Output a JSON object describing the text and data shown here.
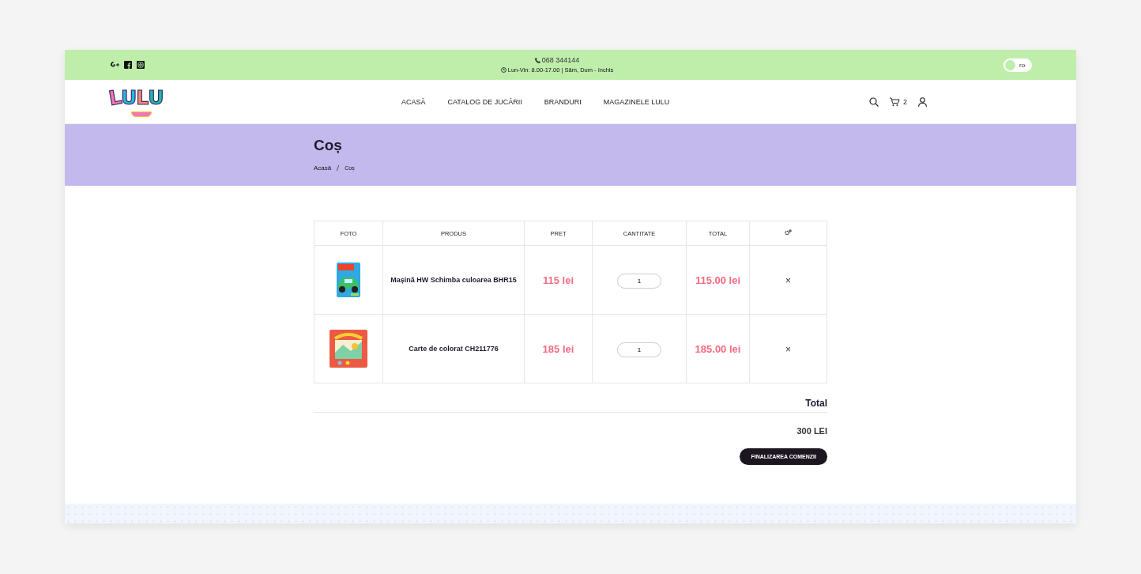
{
  "topbar": {
    "phone": "068 344144",
    "hours": "Lun-Vin: 8.00-17.00 | Săm, Dum - închis",
    "social": [
      {
        "kind": "gplus"
      },
      {
        "kind": "facebook"
      },
      {
        "kind": "instagram"
      }
    ],
    "language": {
      "label": "ro",
      "on": false
    }
  },
  "header": {
    "logo": "LULU",
    "nav": [
      {
        "label": "ACASĂ"
      },
      {
        "label": "CATALOG DE JUCĂRII"
      },
      {
        "label": "BRANDURI"
      },
      {
        "label": "MAGAZINELE LULU"
      }
    ],
    "cart_count": "2"
  },
  "banner": {
    "title": "Coș",
    "breadcrumb": [
      "Acasă",
      "Coș"
    ]
  },
  "table": {
    "columns": [
      "FOTO",
      "PRODUS",
      "PREȚ",
      "CANTITATE",
      "TOTAL"
    ],
    "rows": [
      {
        "product": "Mașină HW Schimba culoarea BHR15",
        "price": "115 lei",
        "quantity": "1",
        "total": "115.00 lei",
        "remove": "×"
      },
      {
        "product": "Carte de colorat CH211776",
        "price": "185 lei",
        "quantity": "1",
        "total": "185.00 lei",
        "remove": "×"
      }
    ]
  },
  "summary": {
    "label": "Total",
    "amount": "300 LEI",
    "button": "FINALIZAREA COMENZII"
  }
}
